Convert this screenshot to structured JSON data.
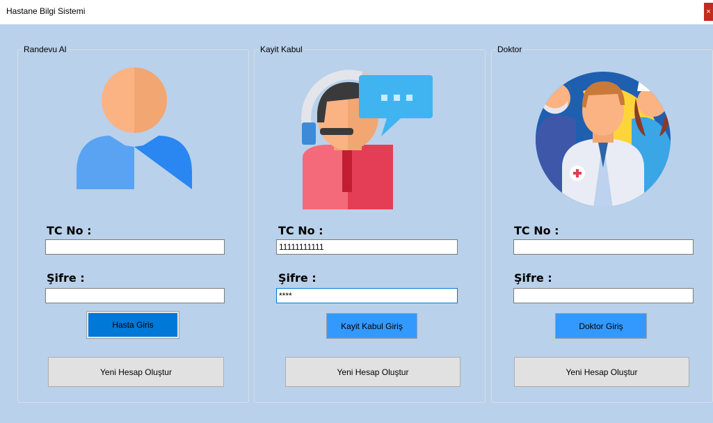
{
  "window": {
    "title": "Hastane Bilgi Sistemi",
    "close_glyph": "×"
  },
  "colors": {
    "background": "#b9d1ea",
    "button_blue": "#3399ff",
    "button_blue_active": "#0078d7"
  },
  "panels": [
    {
      "legend": "Randevu Al",
      "icon": "patient-user-icon",
      "tc_label": "TC No :",
      "tc_value": "",
      "password_label": "Şifre :",
      "password_value": "",
      "login_button": "Hasta Giris",
      "register_button": "Yeni Hesap Oluştur"
    },
    {
      "legend": "Kayit Kabul",
      "icon": "receptionist-chat-icon",
      "tc_label": "TC No :",
      "tc_value": "11111111111",
      "password_label": "Şifre :",
      "password_value": "****",
      "login_button": "Kayit Kabul Giriş",
      "register_button": "Yeni Hesap Oluştur"
    },
    {
      "legend": "Doktor",
      "icon": "medical-staff-icon",
      "tc_label": "TC No :",
      "tc_value": "",
      "password_label": "Şifre :",
      "password_value": "",
      "login_button": "Doktor Giriş",
      "register_button": "Yeni Hesap Oluştur"
    }
  ]
}
